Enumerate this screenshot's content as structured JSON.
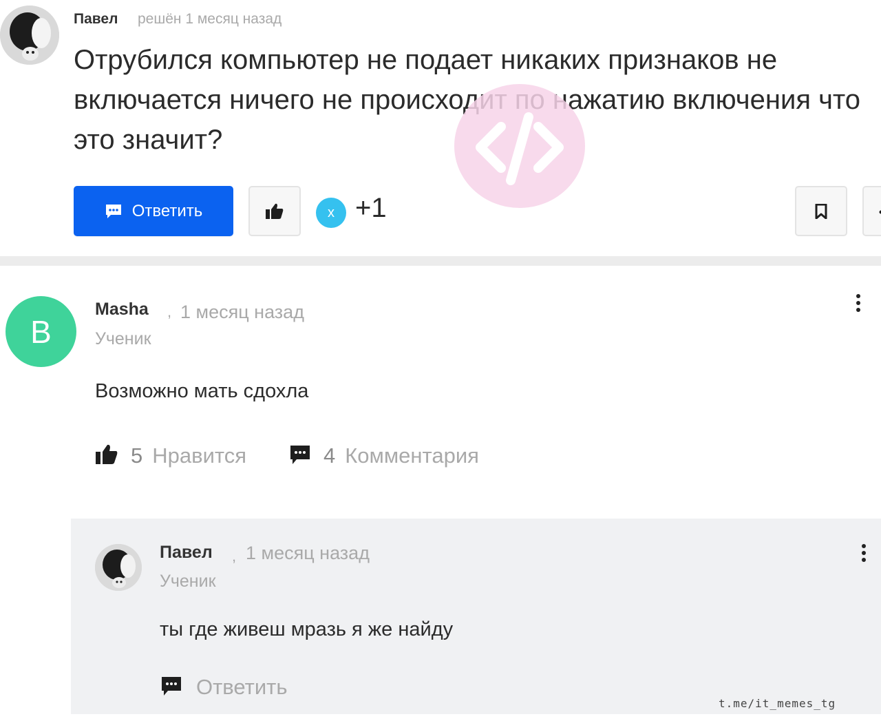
{
  "question": {
    "author": "Павел",
    "meta": "решён 1 месяц назад",
    "text": "Отрубился компьютер не подает никаких признаков не включается ничего не происходит по нажатию включения что это значит?",
    "answer_button": "Ответить",
    "badge_letter": "x",
    "plus_count": "+1"
  },
  "answer": {
    "avatar_letter": "B",
    "author": "Masha",
    "separator": ",",
    "time": "1 месяц назад",
    "role": "Ученик",
    "text": "Возможно мать сдохла",
    "likes_count": "5",
    "likes_label": "Нравится",
    "comments_count": "4",
    "comments_label": "Комментария"
  },
  "reply": {
    "author": "Павел",
    "separator": ",",
    "time": "1 месяц назад",
    "role": "Ученик",
    "text": "ты где живеш мразь я же найду",
    "reply_label": "Ответить"
  },
  "watermark": {
    "credit": "t.me/it_memes_tg",
    "code_symbol": "</>"
  },
  "icons": {
    "answer_button": "comment-icon",
    "like": "thumbs-up-icon",
    "bookmark": "bookmark-icon",
    "more": "more-vertical-icon",
    "comments": "comment-icon",
    "reply": "comment-icon"
  },
  "colors": {
    "primary_button": "#0b62f0",
    "answer_avatar": "#3fd39a",
    "badge": "#35c1ef",
    "watermark_circle": "#f7d4e9",
    "muted_text": "#a9a9a9",
    "reply_background": "#f0f1f3"
  }
}
